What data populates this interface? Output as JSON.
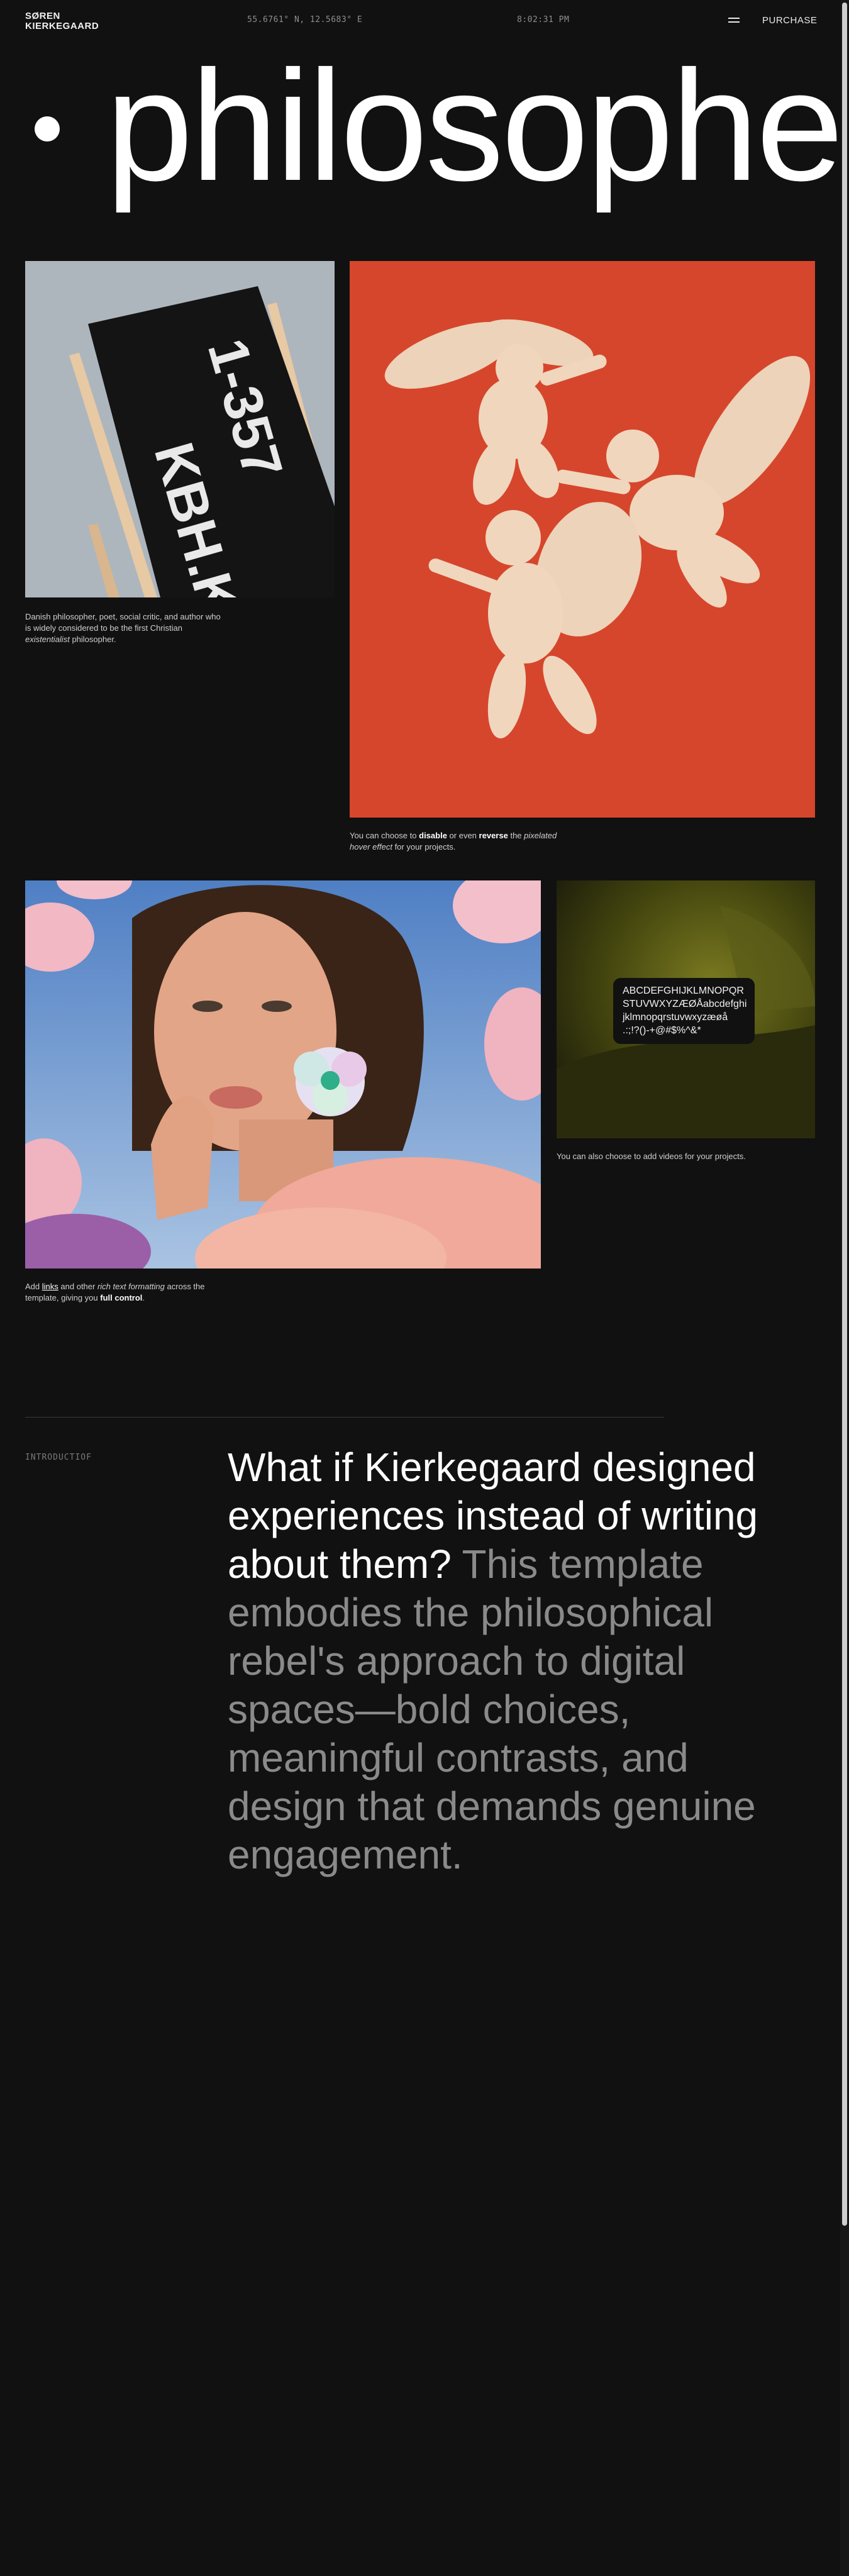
{
  "header": {
    "brand_line1": "SØREN",
    "brand_line2": "KIERKEGAARD",
    "coordinates": "55.6761° N, 12.5683° E",
    "time": "8:02:31 PM",
    "purchase_label": "PURCHASE"
  },
  "hero": {
    "word": "philosophe"
  },
  "gallery": {
    "sign_line1": "1-357",
    "sign_line2": "KBH.K",
    "caption1": {
      "text": "Danish philosopher, poet, social critic, and author who is widely considered to be the first Christian",
      "italic": "existentialist",
      "end": "philosopher."
    },
    "caption2": {
      "pre": "You can choose to",
      "b1": "disable",
      "mid": "or even",
      "b2": "reverse",
      "the": "the",
      "italic": "pixelated hover effect",
      "end": "for your projects."
    },
    "caption3": "You can also choose to add videos for your projects.",
    "caption4": {
      "pre": "Add",
      "link": "links",
      "mid": "and other",
      "italic": "rich text formatting",
      "mid2": "across the template, giving you",
      "bold": "full control",
      "end": "."
    },
    "type_card": {
      "line1": "ABCDEFGHIJKLMNOPQR",
      "line2": "STUVWXYZÆØÅabcdefghi",
      "line3": "jklmnopqrstuvwxyzæøå",
      "line4": ".:;!?()-+@#$%^&*"
    }
  },
  "intro": {
    "label": "INTRODUCTIOF",
    "lead": "What if Kierkegaard designed experiences instead of writing about them?",
    "rest": "This template embodies the philosophical rebel's approach to digital spaces—bold choices, meaningful contrasts, and design that demands genuine engagement."
  },
  "colors": {
    "background": "#111111",
    "accent_red": "#d6462c",
    "muted_text": "#8a8a8a"
  }
}
